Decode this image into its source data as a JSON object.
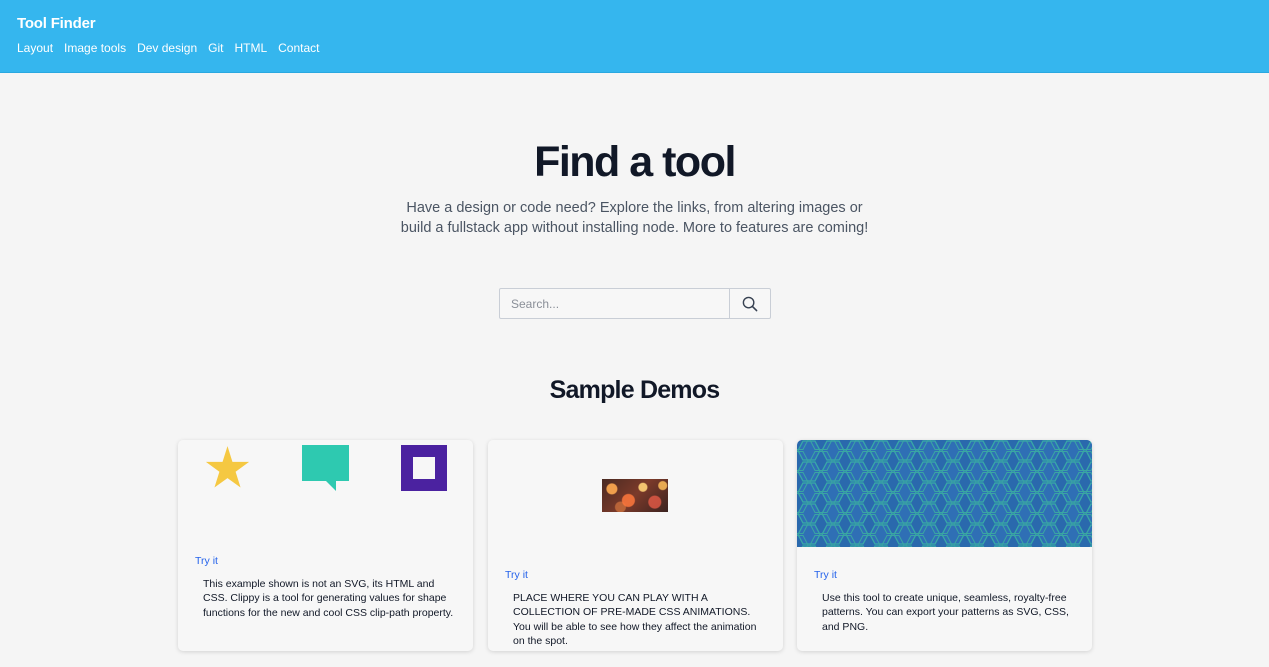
{
  "header": {
    "brand": "Tool Finder",
    "nav": [
      "Layout",
      "Image tools",
      "Dev design",
      "Git",
      "HTML",
      "Contact"
    ]
  },
  "hero": {
    "title": "Find a tool",
    "subtitle": "Have a design or code need? Explore the links, from altering images or build a fullstack app without installing node. More to features are coming!"
  },
  "search": {
    "placeholder": "Search...",
    "value": "",
    "icon": "search-icon"
  },
  "demos": {
    "title": "Sample Demos",
    "cards": [
      {
        "link": "Try it",
        "description": "This example shown is not an SVG, its HTML and CSS. Clippy is a tool for generating values for shape functions for the new and cool CSS clip-path property.",
        "preview": [
          "star-shape",
          "speech-bubble-shape",
          "square-frame-shape"
        ]
      },
      {
        "link": "Try it",
        "description": "PLACE WHERE YOU CAN PLAY WITH A COLLECTION OF PRE-MADE CSS ANIMATIONS. You will be able to see how they affect the animation on the spot.",
        "preview": "bokeh-image"
      },
      {
        "link": "Try it",
        "description": "Use this tool to create unique, seamless, royalty-free patterns. You can export your patterns as SVG, CSS, and PNG.",
        "preview": "hexagon-pattern"
      }
    ]
  },
  "colors": {
    "header_bg": "#35b6ee",
    "link": "#2563eb",
    "star": "#f5c842",
    "bubble": "#2ec9b0",
    "frame": "#4b22a0",
    "pattern_bg": "#2a69ad",
    "pattern_line": "#35a7a8"
  }
}
